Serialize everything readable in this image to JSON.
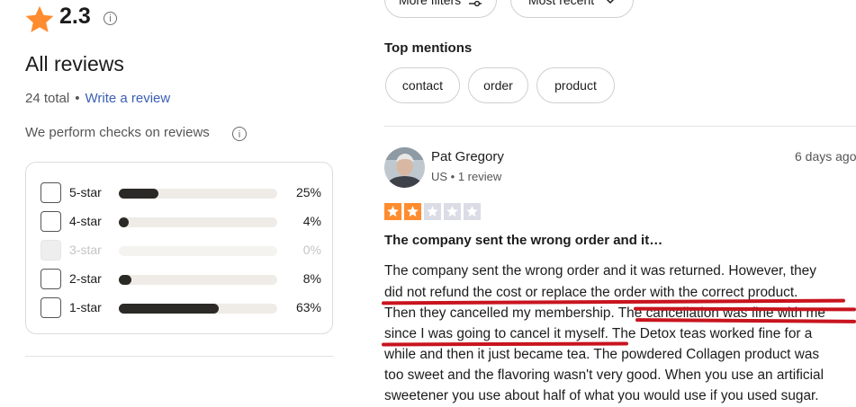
{
  "summary": {
    "rating": "2.3",
    "title": "All reviews",
    "total_text": "24 total",
    "separator": "•",
    "write_review": "Write a review",
    "checks_text": "We perform checks on reviews",
    "info_glyph": "i"
  },
  "distribution": [
    {
      "label": "5-star",
      "percent_text": "25%",
      "fraction": 0.25,
      "enabled": true
    },
    {
      "label": "4-star",
      "percent_text": "4%",
      "fraction": 0.04,
      "enabled": true
    },
    {
      "label": "3-star",
      "percent_text": "0%",
      "fraction": 0.0,
      "enabled": false
    },
    {
      "label": "2-star",
      "percent_text": "8%",
      "fraction": 0.08,
      "enabled": true
    },
    {
      "label": "1-star",
      "percent_text": "63%",
      "fraction": 0.63,
      "enabled": true
    }
  ],
  "filters": {
    "more_filters": "More filters",
    "sort": "Most recent"
  },
  "mentions": {
    "title": "Top mentions",
    "items": [
      "contact",
      "order",
      "product"
    ]
  },
  "review": {
    "reviewer_name": "Pat Gregory",
    "reviewer_meta": "US • 1 review",
    "date": "6 days ago",
    "stars": 2,
    "stars_max": 5,
    "title": "The company sent the wrong order and it…",
    "lines": [
      "The company sent the wrong order and it was returned. However, they",
      "did not refund the cost or replace the order with the correct product.",
      "Then they cancelled my membership. The cancellation was fine with me",
      "since I was going to cancel it myself. The Detox teas worked fine for a",
      "while and then it just became tea. The powdered Collagen product was",
      "too sweet and the flavoring wasn't very good. When you use an artificial",
      "sweetener you use about half of what you would use if you used sugar."
    ]
  },
  "colors": {
    "brand_star": "#ff8c2e",
    "star_filled": "#ff8c2e",
    "star_empty": "#dcdce6",
    "bar_fill": "#2b2a26",
    "link": "#3b5fb5",
    "annotation": "#c8141e"
  },
  "icons": {
    "rating": "star-icon",
    "info": "info-icon",
    "filter": "sliders-icon",
    "sort": "chevron-down-icon"
  }
}
